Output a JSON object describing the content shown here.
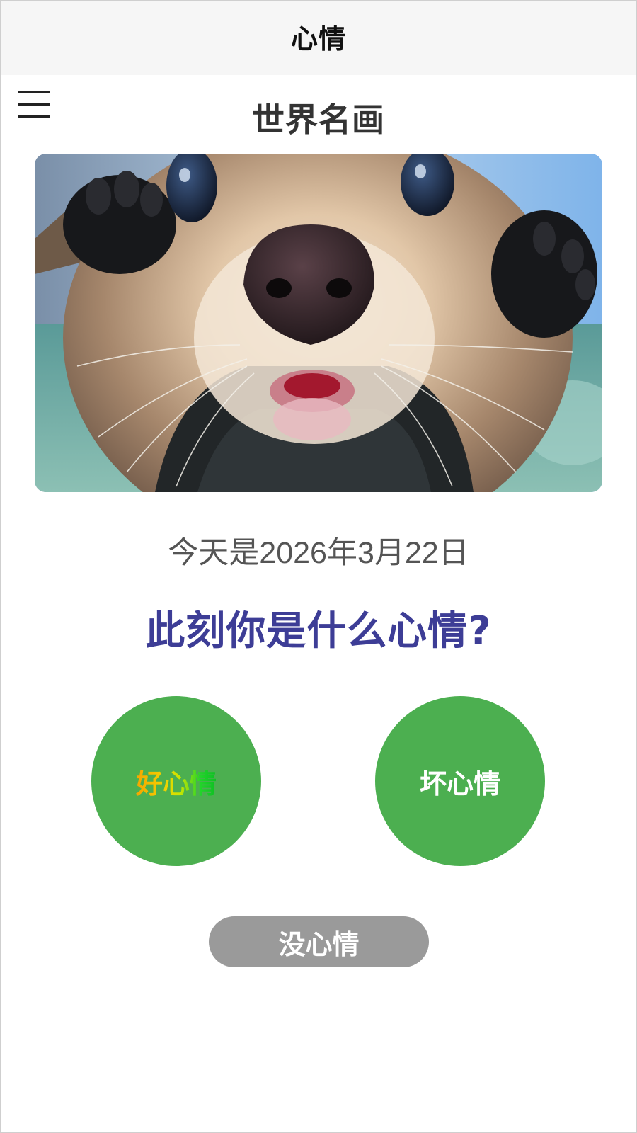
{
  "topbar": {
    "title": "心情"
  },
  "menu": {
    "icon": "hamburger-menu-icon"
  },
  "page": {
    "title": "世界名画"
  },
  "hero": {
    "subject": "close-up otter photo"
  },
  "date_text": "今天是2026年3月22日",
  "question": "此刻你是什么心情?",
  "moods": {
    "good": {
      "label": "好心情",
      "color": "#4caf50"
    },
    "bad": {
      "label": "坏心情",
      "color": "#4caf50"
    },
    "none": {
      "label": "没心情",
      "color": "#9a9a9a"
    }
  },
  "colors": {
    "question": "#3d3d96",
    "topbar_bg": "#f6f6f6"
  }
}
